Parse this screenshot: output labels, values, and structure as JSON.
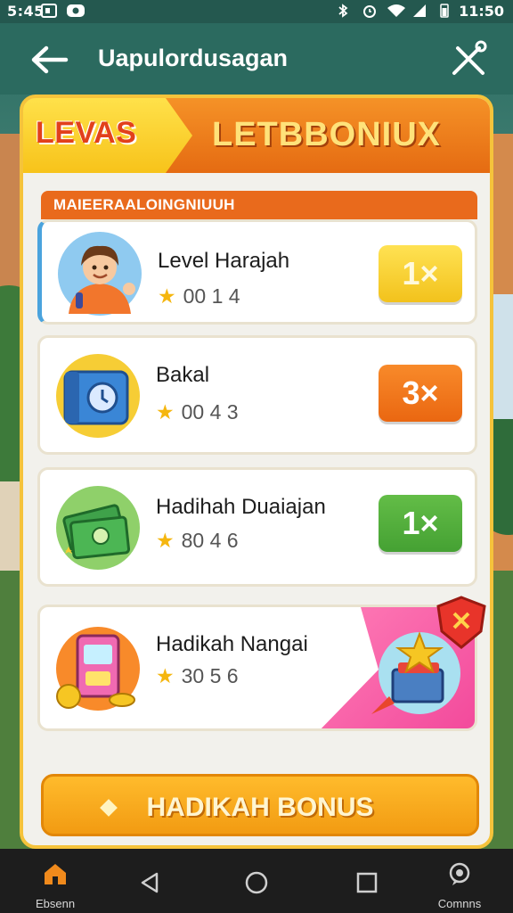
{
  "status_bar": {
    "time_left": "5:45",
    "time_right": "11:50"
  },
  "header": {
    "title": "Uapulordusagan",
    "back_icon": "arrow-left-icon",
    "close_icon": "close-icon"
  },
  "banner": {
    "left_label": "LEVAS",
    "right_label": "LETBBONIUX"
  },
  "section": {
    "subheader": "MAIEERAALOINGNIUUH"
  },
  "rewards": [
    {
      "name": "Level Harajah",
      "rating": "00 1 4",
      "multiplier": "1×",
      "color": "#f6c92a",
      "icon": "character-icon"
    },
    {
      "name": "Bakal",
      "rating": "00 4 3",
      "multiplier": "3×",
      "color": "#f0751b",
      "icon": "wallet-icon"
    },
    {
      "name": "Hadihah Duaiajan",
      "rating": "80 4 6",
      "multiplier": "1×",
      "color": "#55ad3c",
      "icon": "cash-stack-icon"
    },
    {
      "name": "Hadikah Nangai",
      "rating": "30 5 6",
      "multiplier": "",
      "color": "#f25da2",
      "icon": "arcade-machine-icon"
    }
  ],
  "claim_button": {
    "label": "HADIKAH BONUS"
  },
  "nav": {
    "home_label": "Ebsenn",
    "comms_label": "Comnns"
  }
}
